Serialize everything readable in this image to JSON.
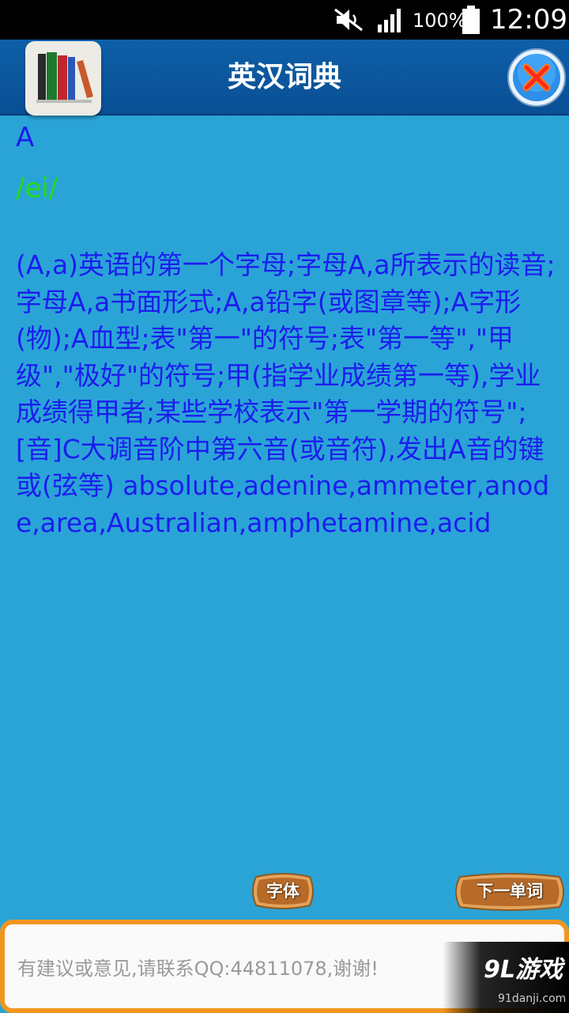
{
  "status_bar": {
    "battery_percent": "100%",
    "time": "12:09",
    "icons": [
      "mute-icon",
      "signal-icon",
      "battery-icon"
    ]
  },
  "header": {
    "title": "英汉词典",
    "app_icon": "books-icon",
    "close_icon": "close-icon"
  },
  "entry": {
    "word": "A",
    "phonetic": "/ei/",
    "definition": "(A,a)英语的第一个字母;字母A,a所表示的读音;字母A,a书面形式;A,a铅字(或图章等);A字形(物);A血型;表\"第一\"的符号;表\"第一等\",\"甲级\",\"极好\"的符号;甲(指学业成绩第一等),学业成绩得甲者;某些学校表示\"第一学期的符号\";[音]C大调音阶中第六音(或音符),发出A音的键或(弦等) absolute,adenine,ammeter,anode,area,Australian,amphetamine,acid"
  },
  "buttons": {
    "font_label": "字体",
    "next_word_label": "下一单词"
  },
  "footer": {
    "feedback_text": "有建议或意见,请联系QQ:44811078,谢谢!"
  },
  "watermark": {
    "logo": "9L游戏",
    "site": "91danji.com"
  },
  "colors": {
    "background": "#2aa4d6",
    "title_bar": "#0d5fa8",
    "definition_text": "#1c1cf0",
    "phonetic_text": "#22dd11",
    "footer_border": "#f0961e"
  }
}
